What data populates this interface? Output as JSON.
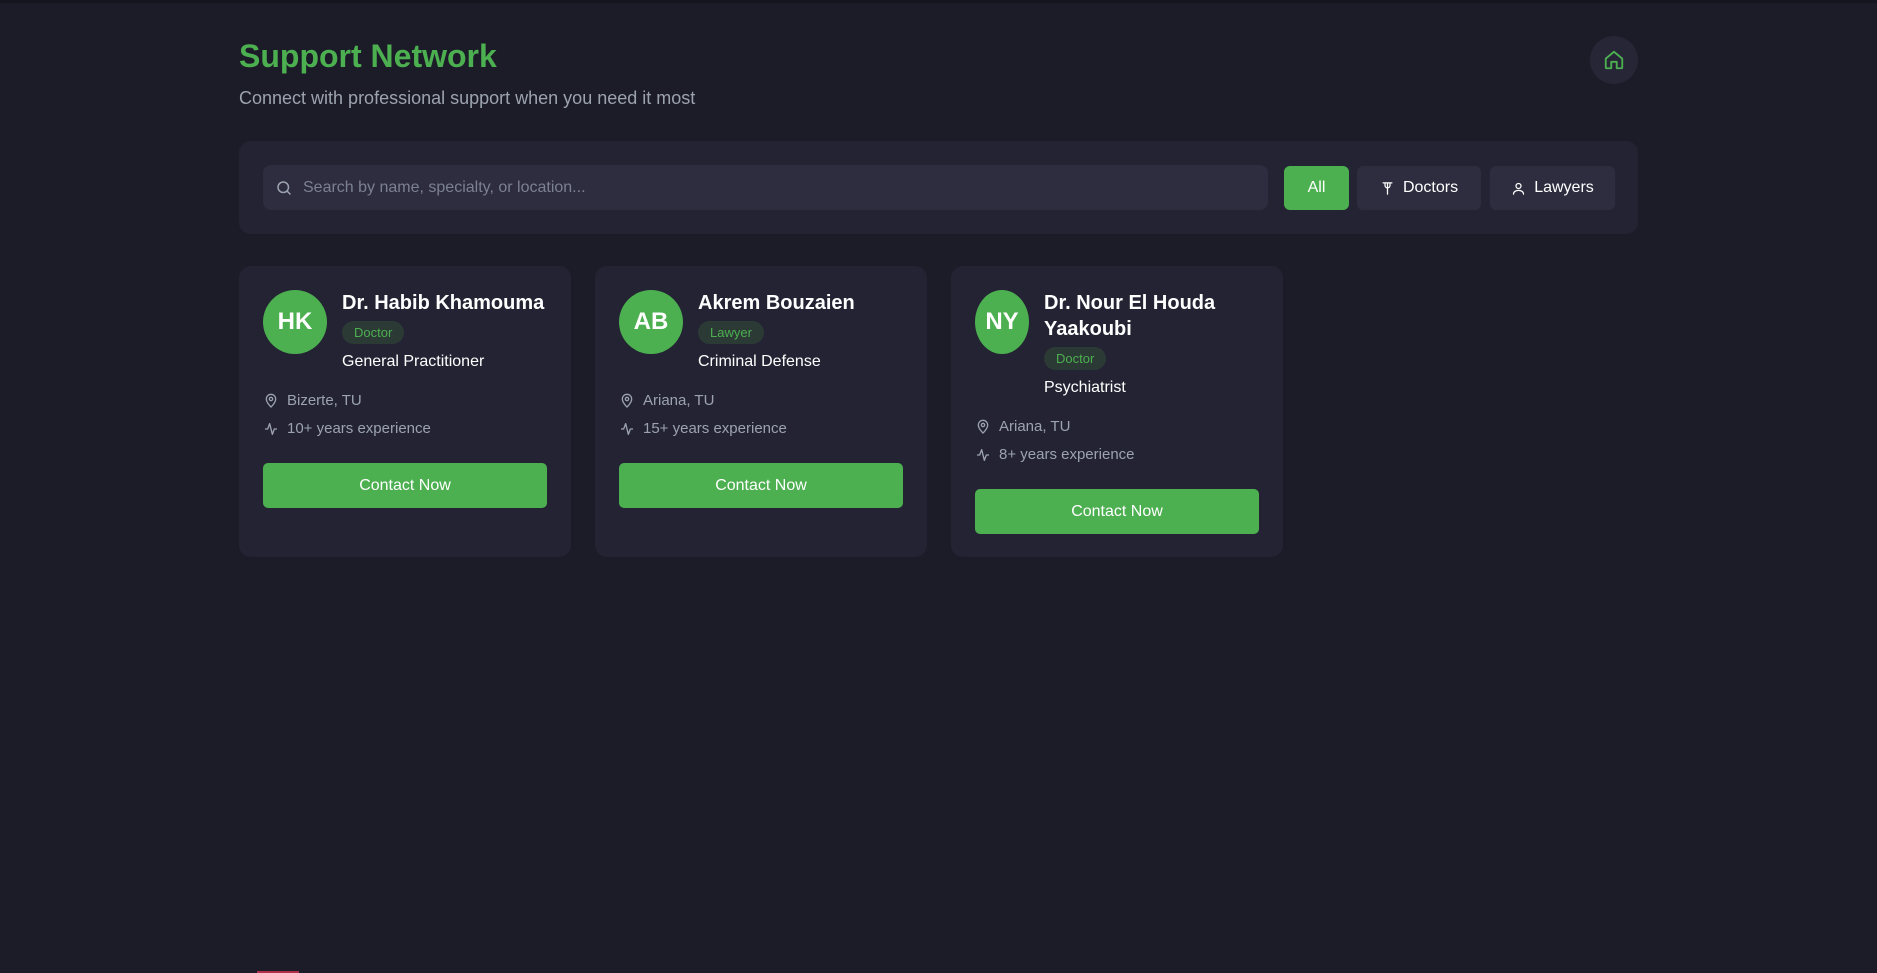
{
  "header": {
    "title": "Support Network",
    "subtitle": "Connect with professional support when you need it most",
    "home_icon": "home-icon"
  },
  "search": {
    "placeholder": "Search by name, specialty, or location...",
    "value": ""
  },
  "filters": [
    {
      "label": "All",
      "active": true
    },
    {
      "label": "Doctors",
      "icon": "stethoscope-icon"
    },
    {
      "label": "Lawyers",
      "icon": "user-icon"
    }
  ],
  "cards": [
    {
      "initials": "HK",
      "name": "Dr. Habib Khamouma",
      "type": "Doctor",
      "specialty": "General Practitioner",
      "location": "Bizerte, TU",
      "experience": "10+ years experience",
      "button": "Contact Now"
    },
    {
      "initials": "AB",
      "name": "Akrem Bouzaien",
      "type": "Lawyer",
      "specialty": "Criminal Defense",
      "location": "Ariana, TU",
      "experience": "15+ years experience",
      "button": "Contact Now"
    },
    {
      "initials": "NY",
      "name": "Dr. Nour El Houda Yaakoubi",
      "type": "Doctor",
      "specialty": "Psychiatrist",
      "location": "Ariana, TU",
      "experience": "8+ years experience",
      "button": "Contact Now"
    }
  ],
  "colors": {
    "accent": "#4caf50",
    "background": "#1c1c29",
    "panel": "#232333"
  }
}
